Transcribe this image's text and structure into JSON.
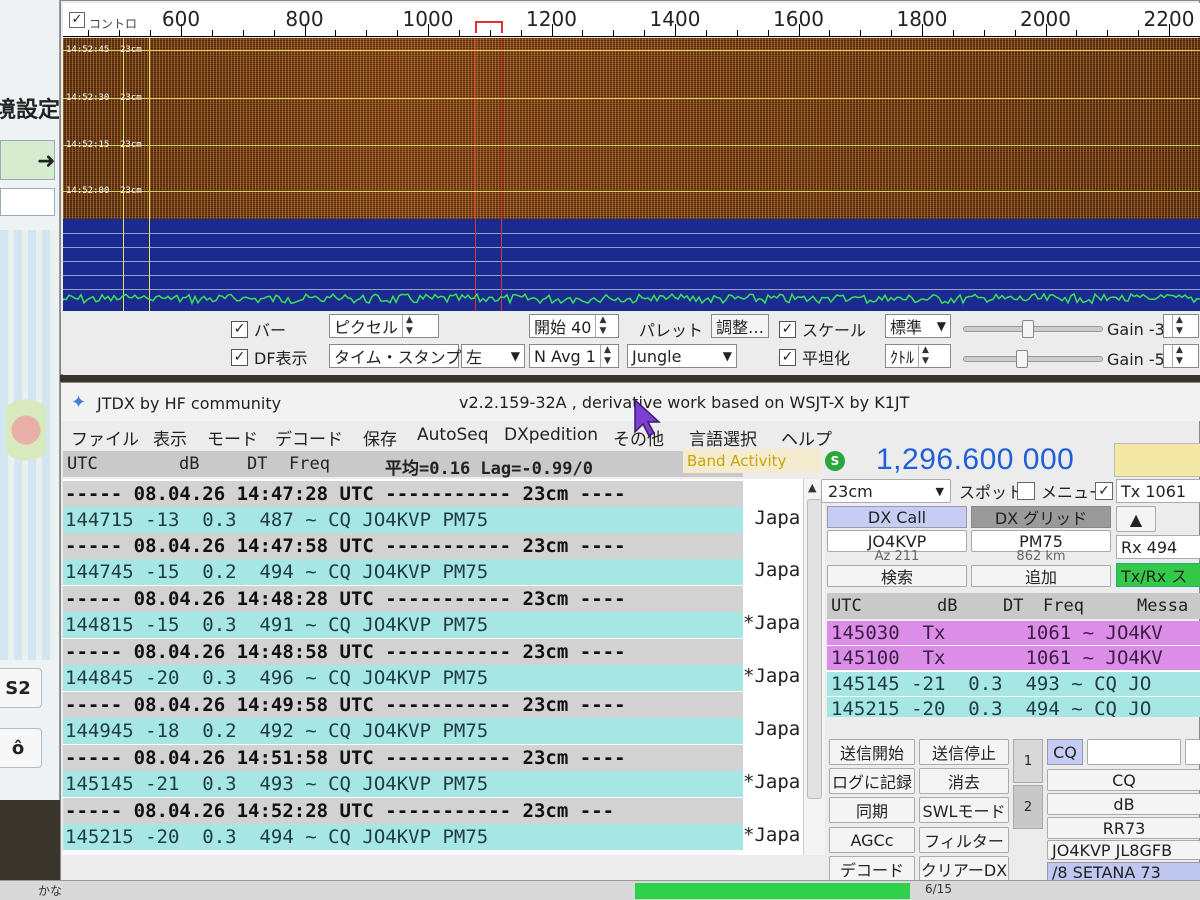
{
  "background_app": {
    "title": "境設定",
    "button_a": "S2",
    "button_b": "ô"
  },
  "waterfall": {
    "ruler_ticks": [
      "600",
      "800",
      "1000",
      "1200",
      "1400",
      "1600",
      "1800",
      "2000",
      "2200"
    ],
    "ruler_checkbox_label": "コントロ",
    "timestamps": [
      "14:52:45",
      "14:52:30",
      "14:52:15",
      "14:52:00"
    ],
    "band_label": "23cm",
    "controls": {
      "bar_label": "バー",
      "df_label": "DF表示",
      "pixel_value": "ピクセル",
      "timestamp_value": "タイム・スタンプ",
      "left_value": "左",
      "start_value": "開始 40",
      "navg_value": "N Avg 1",
      "palette_label": "パレット",
      "adjust_button": "調整…",
      "palette_value": "Jungle",
      "scale_label": "スケール",
      "flatten_label": "平坦化",
      "standard_value": "標準",
      "kuru_value": "ｸﾄﾙ",
      "gain1_label": "Gain -3",
      "gain2_label": "Gain -5"
    }
  },
  "jtdx": {
    "app_title": "JTDX  by HF community",
    "version": "v2.2.159-32A , derivative work based on WSJT-X by K1JT",
    "menu": [
      "ファイル",
      "表示",
      "モード",
      "デコード",
      "保存",
      "AutoSeq",
      "DXpedition",
      "その他",
      "言語選択",
      "ヘルプ"
    ],
    "header": {
      "utc": "UTC",
      "db": "dB",
      "dt": "DT",
      "freq": "Freq",
      "avg": "平均=0.16 Lag=-0.99/0"
    },
    "band_activity": "Band Activity",
    "s_badge": "S",
    "frequency": "1,296.600 000",
    "rows": [
      {
        "kind": "sep",
        "text": "----- 08.04.26 14:47:28 UTC ----------- 23cm ----",
        "country": ""
      },
      {
        "kind": "dec",
        "text": "144715 -13  0.3  487 ~ CQ JO4KVP PM75",
        "country": " Japa"
      },
      {
        "kind": "sep",
        "text": "----- 08.04.26 14:47:58 UTC ----------- 23cm ----",
        "country": ""
      },
      {
        "kind": "dec",
        "text": "144745 -15  0.2  494 ~ CQ JO4KVP PM75",
        "country": " Japa"
      },
      {
        "kind": "sep",
        "text": "----- 08.04.26 14:48:28 UTC ----------- 23cm ----",
        "country": ""
      },
      {
        "kind": "dec",
        "text": "144815 -15  0.3  491 ~ CQ JO4KVP PM75",
        "country": "*Japa"
      },
      {
        "kind": "sep",
        "text": "----- 08.04.26 14:48:58 UTC ----------- 23cm ----",
        "country": ""
      },
      {
        "kind": "dec",
        "text": "144845 -20  0.3  496 ~ CQ JO4KVP PM75",
        "country": "*Japa"
      },
      {
        "kind": "sep",
        "text": "----- 08.04.26 14:49:58 UTC ----------- 23cm ----",
        "country": ""
      },
      {
        "kind": "dec",
        "text": "144945 -18  0.2  492 ~ CQ JO4KVP PM75",
        "country": " Japa"
      },
      {
        "kind": "sep",
        "text": "----- 08.04.26 14:51:58 UTC ----------- 23cm ----",
        "country": ""
      },
      {
        "kind": "dec",
        "text": "145145 -21  0.3  493 ~ CQ JO4KVP PM75",
        "country": "*Japa"
      },
      {
        "kind": "sep",
        "text": "----- 08.04.26 14:52:28 UTC ----------- 23cm ---",
        "country": ""
      },
      {
        "kind": "dec",
        "text": "145215 -20  0.3  494 ~ CQ JO4KVP PM75",
        "country": "*Japa"
      }
    ],
    "right_panel": {
      "band_select": "23cm",
      "spot_label": "スポット",
      "menu_label": "メニュー",
      "tx_value": "Tx  1061",
      "rx_value": "Rx  494",
      "dx_call_label": "DX Call",
      "dx_grid_label": "DX グリッド",
      "dx_call_value": "JO4KVP",
      "dx_grid_value": "PM75",
      "az_value": "Az 211",
      "distance_value": "862 km",
      "search_button": "検索",
      "add_button": "追加",
      "txrx_button": "Tx/Rx ス",
      "header": {
        "utc": "UTC",
        "db": "dB",
        "dt": "DT",
        "freq": "Freq",
        "msg": "Messa"
      },
      "rows": [
        {
          "kind": "tx",
          "text": "145030  Tx       1061 ~ JO4KV"
        },
        {
          "kind": "tx",
          "text": "145100  Tx       1061 ~ JO4KV"
        },
        {
          "kind": "dec",
          "text": "145145 -21  0.3  493 ~ CQ JO"
        },
        {
          "kind": "dec",
          "text": "145215 -20  0.3  494 ~ CQ JO"
        }
      ],
      "buttons": {
        "tx_start": "送信開始",
        "tx_stop": "送信停止",
        "log": "ログに記録",
        "erase": "消去",
        "sync": "同期",
        "swl": "SWLモード",
        "agcc": "AGCc",
        "filter": "フィルター",
        "decode": "デコード",
        "clear_dx": "クリアーDX"
      },
      "tab1": "1",
      "tab2": "2",
      "cq_label": "CQ",
      "msgs": [
        "CQ",
        "dB",
        "RR73",
        "JO4KVP JL8GFB",
        "/8 SETANA 73"
      ]
    }
  },
  "taskbar": {
    "label": "かな",
    "page": "6/15"
  },
  "colors": {
    "decode_row": "#a6e6e3",
    "separator_row": "#d2d2d2",
    "tx_row": "#dc8de8",
    "frequency_text": "#1f5fd8",
    "spectrum_bg": "#1a2a8f",
    "spectrum_trace": "#39e05a"
  }
}
